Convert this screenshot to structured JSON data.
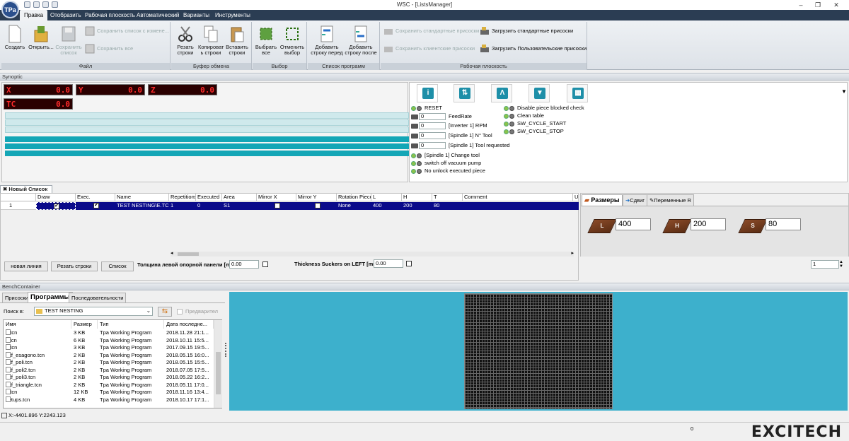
{
  "window": {
    "title": "WSC - [ListsManager]",
    "logo": "ТPa"
  },
  "menu": [
    "Правка",
    "Отобразить",
    "Рабочая плоскость",
    "Автоматический",
    "Варианты",
    "Инструменты"
  ],
  "ribbon": {
    "file": {
      "label": "Файл",
      "create": "Создать",
      "open": "Открыть...",
      "save_list": "Сохранить список",
      "save_as": "Сохранить список с измене...",
      "save_all": "Сохранить все"
    },
    "clipboard": {
      "label": "Буфер обмена",
      "cut": "Резать строки",
      "copy": "Копироват ь строки",
      "paste": "Вставить строки"
    },
    "select": {
      "label": "Выбор",
      "select_all": "Выбрать все",
      "deselect": "Отменить выбор"
    },
    "program_list": {
      "label": "Список программ",
      "add_before": "Добавить строку перед",
      "add_after": "Добавить строку после"
    },
    "workplane": {
      "label": "Рабочая плоскость",
      "save_std": "Сохранить стандартные присоски",
      "save_client": "Сохранить клиентские присоски",
      "load_std": "Загрузить стандартные присоски",
      "load_user": "Загрузить Пользовательские присоски"
    }
  },
  "synoptic": {
    "header": "Synoptic",
    "readouts": [
      {
        "label": "X",
        "value": "0.0"
      },
      {
        "label": "Y",
        "value": "0.0"
      },
      {
        "label": "Z",
        "value": "0.0"
      },
      {
        "label": "TC",
        "value": "0.0"
      }
    ],
    "status_col1": [
      "RESET"
    ],
    "numeric_rows": [
      {
        "value": "0",
        "label": "FeedRate"
      },
      {
        "value": "0",
        "label": "[Inverter 1] RPM"
      },
      {
        "value": "0",
        "label": "[Spindle 1] N° Tool"
      },
      {
        "value": "0",
        "label": "[Spindle 1] Tool requested"
      }
    ],
    "status_col1_bottom": [
      "[Spindle 1] Change tool",
      "switch off vacuum pump",
      "No unlock executed piece"
    ],
    "status_col2": [
      "Disable piece blocked check",
      "Clean table",
      "SW_CYCLE_START",
      "SW_CYCLE_STOP"
    ]
  },
  "list": {
    "tab": "Новый Список 1*",
    "headers": [
      "",
      "Draw",
      "Exec.",
      "Name",
      "Repetitions",
      "Executed",
      "Area",
      "Mirror X",
      "Mirror Y",
      "Rotation Piece",
      "L",
      "H",
      "T",
      "Comment",
      "U"
    ],
    "row": {
      "num": "1",
      "draw": "✔",
      "exec": "✔",
      "name": "TEST NESTING\\E.TC",
      "repetitions": "1",
      "executed": "0",
      "area": "S1",
      "mirror_x": "",
      "mirror_y": "",
      "rotation": "None",
      "l": "400",
      "h": "200",
      "t": "80",
      "comment": ""
    },
    "buttons": {
      "new_line": "новая линия",
      "cut_rows": "Резать строки",
      "list": "Список"
    },
    "left_panel_label": "Толщина левой опорной панели [mm]",
    "left_panel_value": "0.00",
    "suckers_label": "Thickness Suckers on LEFT [mm]",
    "suckers_value": "0.00",
    "spinner_value": "1"
  },
  "dimensions": {
    "tabs": [
      "Размеры",
      "Сдвиг",
      "Переменные R"
    ],
    "L": {
      "label": "L",
      "value": "400"
    },
    "H": {
      "label": "H",
      "value": "200"
    },
    "S": {
      "label": "S",
      "value": "80"
    }
  },
  "bench": {
    "header": "BenchContainer",
    "tabs": [
      "Присоски",
      "Программы",
      "Последовательности"
    ],
    "search_label": "Поиск в:",
    "folder": "TEST NESTING",
    "preview": "Предварител",
    "columns": [
      "Имя",
      "Размер",
      "Тип",
      "Дата последне..."
    ],
    "files": [
      {
        "name": "b.tcn",
        "size": "3 KB",
        "type": "Tpa Working Program",
        "date": "2018.11.28 21:1..."
      },
      {
        "name": "c.tcn",
        "size": "6 KB",
        "type": "Tpa Working Program",
        "date": "2018.10.11 15:5..."
      },
      {
        "name": "d.tcn",
        "size": "3 KB",
        "type": "Tpa Working Program",
        "date": "2017.09.15 19:5..."
      },
      {
        "name": "dxf_esagono.tcn",
        "size": "2 KB",
        "type": "Tpa Working Program",
        "date": "2018.05.15 16:0..."
      },
      {
        "name": "dxf_poli.tcn",
        "size": "2 KB",
        "type": "Tpa Working Program",
        "date": "2018.05.15 15:5..."
      },
      {
        "name": "dxf_poli2.tcn",
        "size": "2 KB",
        "type": "Tpa Working Program",
        "date": "2018.07.05 17:5..."
      },
      {
        "name": "dxf_poli3.tcn",
        "size": "2 KB",
        "type": "Tpa Working Program",
        "date": "2018.05.22 16:2..."
      },
      {
        "name": "dxf_triangle.tcn",
        "size": "2 KB",
        "type": "Tpa Working Program",
        "date": "2018.05.11 17:0..."
      },
      {
        "name": "e.tcn",
        "size": "12 KB",
        "type": "Tpa Working Program",
        "date": "2018.11.16 13:4..."
      },
      {
        "name": "setups.tcn",
        "size": "4 KB",
        "type": "Tpa Working Program",
        "date": "2018.10.17 17:1..."
      }
    ],
    "coords": "X:-4401.896 Y:2243.123"
  },
  "status": {
    "value": "0",
    "brand": "EXCITECH"
  },
  "colors": {
    "menubar": "#2b3d53",
    "bench": "#3db0cc",
    "selection": "#0a0a8a",
    "readout": "#ff2a2a"
  }
}
